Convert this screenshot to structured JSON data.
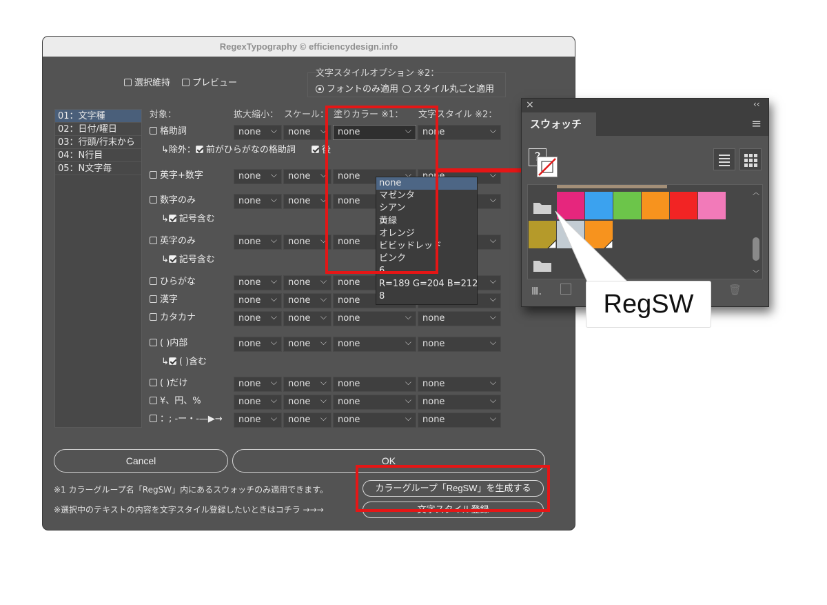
{
  "dialog": {
    "title": "RegexTypography © efficiencydesign.info",
    "keep_selection": "選択維持",
    "preview": "プレビュー",
    "style_option_title": "文字スタイルオプション ※2：",
    "radio_font_only": "フォントのみ適用",
    "radio_full_style": "スタイル丸ごと適用",
    "tabs": [
      "01：文字種",
      "02：日付/曜日",
      "03：行頭/行末から",
      "04：N行目",
      "05：N文字毎"
    ],
    "headers": {
      "target": "対象：",
      "scale": "拡大縮小：",
      "scale2": "スケール：",
      "fill": "塗りカラー ※1：",
      "char_style": "文字スタイル ※2："
    },
    "rows": [
      {
        "label": "格助詞",
        "checked": false
      },
      {
        "label": "英字+数字",
        "checked": false
      },
      {
        "label": "数字のみ",
        "checked": false
      },
      {
        "label": "英字のみ",
        "checked": false
      },
      {
        "label": "ひらがな",
        "checked": false
      },
      {
        "label": "漢字",
        "checked": false
      },
      {
        "label": "カタカナ",
        "checked": false
      },
      {
        "label": "( )内部",
        "checked": false
      },
      {
        "label": "( )だけ",
        "checked": false
      },
      {
        "label": "¥、円、%",
        "checked": false
      },
      {
        "label": "：; -ー・-—▶→",
        "checked": false
      }
    ],
    "sub_exclude_prefix": "↳除外：",
    "sub_exclude_label": "前がひらがなの格助詞",
    "sub_exclude_trunc": "後",
    "sub_symbol_1": "記号含む",
    "sub_symbol_2": "記号含む",
    "sub_paren": "( )含む",
    "sub_arrow": "↳",
    "select_value": "none",
    "dropdown_options": [
      "none",
      "マゼンタ",
      "シアン",
      "黄緑",
      "オレンジ",
      "ビビッドレッド",
      "ピンク",
      "6",
      "R=189 G=204 B=212",
      "8"
    ],
    "cancel": "Cancel",
    "ok": "OK",
    "note1": "※1 カラーグループ名「RegSW」内にあるスウォッチのみ適用できます。",
    "note2": "※選択中のテキストの内容を文字スタイル登録したいときはコチラ →→→",
    "gen_button": "カラーグループ「RegSW」を生成する",
    "style_reg_button": "文字スタイル登録"
  },
  "swatches": {
    "panel_title": "スウォッチ",
    "close": "×",
    "collapse": "‹‹",
    "question": "?",
    "colors_row1": [
      "#e6267d",
      "#3ba2ef",
      "#6cc54a",
      "#f7931e",
      "#f22424",
      "#f27ab9"
    ],
    "colors_row2": [
      "#b59a2a",
      "#c3ccd3",
      "#f7931e"
    ],
    "callout": "RegSW"
  }
}
